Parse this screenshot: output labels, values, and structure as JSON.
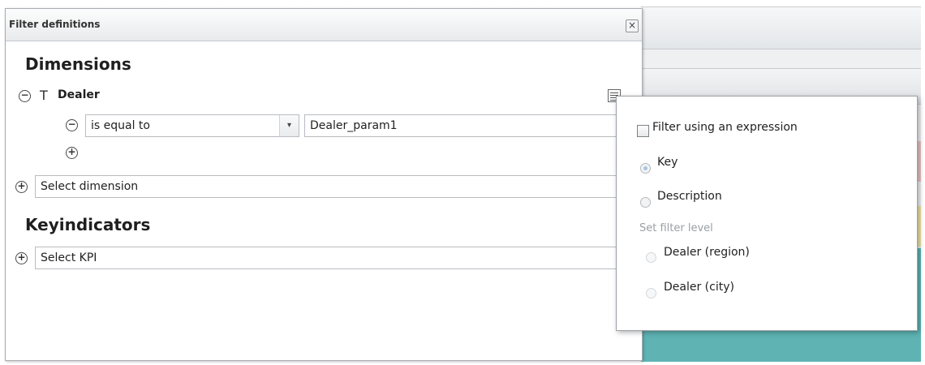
{
  "dialog": {
    "title": "Filter definitions",
    "close_label": "×"
  },
  "dimensions": {
    "heading": "Dimensions",
    "items": [
      {
        "label": "Dealer",
        "operator": "is equal to",
        "value": "Dealer_param1"
      }
    ],
    "select_placeholder": "Select dimension"
  },
  "keyindicators": {
    "heading": "Keyindicators",
    "select_placeholder": "Select KPI"
  },
  "filter_popup": {
    "expression_label": "Filter using an expression",
    "radio_options": [
      {
        "label": "Key",
        "selected": true
      },
      {
        "label": "Description",
        "selected": false
      }
    ],
    "filter_level_heading": "Set filter level",
    "levels": [
      {
        "label": "Dealer (region)"
      },
      {
        "label": "Dealer (city)"
      }
    ]
  },
  "icons": {
    "minus": "−",
    "plus": "+",
    "type": "T",
    "dropdown": "▾"
  }
}
